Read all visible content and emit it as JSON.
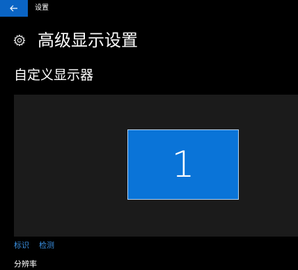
{
  "titlebar": {
    "back_icon": "back-arrow-icon",
    "app_title": "设置",
    "accent_color": "#0a64c4"
  },
  "header": {
    "icon": "gear-icon",
    "title": "高级显示设置"
  },
  "section": {
    "title": "自定义显示器"
  },
  "display_canvas": {
    "monitors": [
      {
        "label": "1",
        "color": "#0a74d8"
      }
    ]
  },
  "links": {
    "identify": "标识",
    "detect": "检测"
  },
  "next_label": "分辨率"
}
